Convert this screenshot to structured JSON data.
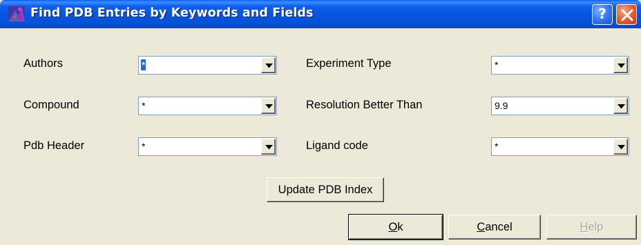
{
  "window": {
    "title": "Find PDB Entries by Keywords and Fields",
    "icons": {
      "app": "pdb-app-icon",
      "help": "help-icon",
      "close": "close-icon"
    },
    "colors": {
      "titlebar": "#0854e0",
      "face": "#ece9d8",
      "close": "#e05a32",
      "selection": "#316ac5"
    }
  },
  "help_button": {
    "label": "?"
  },
  "fields": {
    "authors": {
      "label": "Authors",
      "value": "*"
    },
    "compound": {
      "label": "Compound",
      "value": "*"
    },
    "pdb_header": {
      "label": "Pdb Header",
      "value": "*"
    },
    "experiment_type": {
      "label": "Experiment Type",
      "value": "*"
    },
    "resolution": {
      "label": "Resolution Better Than",
      "value": "9.9"
    },
    "ligand_code": {
      "label": "Ligand code",
      "value": "*"
    }
  },
  "buttons": {
    "update_index": "Update PDB Index",
    "ok": {
      "mnemonic": "O",
      "rest": "k"
    },
    "cancel": {
      "mnemonic": "C",
      "rest": "ancel"
    },
    "help": {
      "mnemonic": "H",
      "rest": "elp",
      "enabled": false
    }
  }
}
